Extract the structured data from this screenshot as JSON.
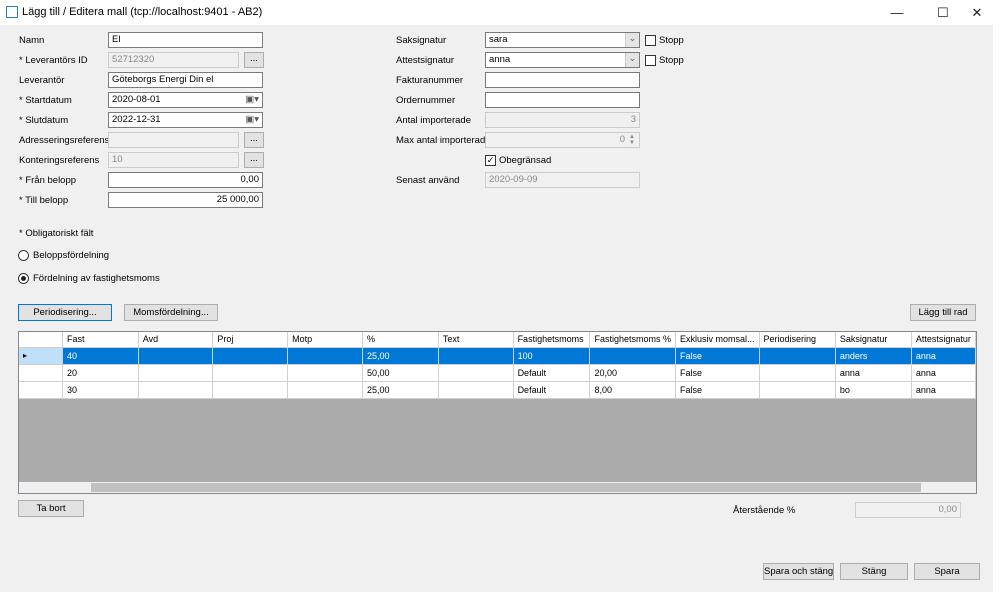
{
  "window": {
    "title": "Lägg till / Editera mall (tcp://localhost:9401 - AB2)"
  },
  "left": {
    "namn": {
      "label": "Namn",
      "value": "El"
    },
    "leverantor_id": {
      "label": "* Leverantörs ID",
      "value": "52712320"
    },
    "leverantor": {
      "label": "Leverantör",
      "value": "Göteborgs Energi Din el"
    },
    "startdatum": {
      "label": "* Startdatum",
      "value": "2020-08-01"
    },
    "slutdatum": {
      "label": "* Slutdatum",
      "value": "2022-12-31"
    },
    "adressering": {
      "label": "Adresseringsreferens",
      "value": ""
    },
    "kontering": {
      "label": "Konteringsreferens",
      "value": "10"
    },
    "fran": {
      "label": "* Från belopp",
      "value": "0,00"
    },
    "till": {
      "label": "* Till belopp",
      "value": "25 000,00"
    },
    "browse": "...",
    "required_note": "* Obligatoriskt fält",
    "radio1": "Beloppsfördelning",
    "radio2": "Fördelning av fastighetsmoms"
  },
  "right": {
    "saksignatur": {
      "label": "Saksignatur",
      "value": "sara"
    },
    "attestsignatur": {
      "label": "Attestsignatur",
      "value": "anna"
    },
    "stopp": "Stopp",
    "fakturanummer": {
      "label": "Fakturanummer",
      "value": ""
    },
    "ordernummer": {
      "label": "Ordernummer",
      "value": ""
    },
    "antal": {
      "label": "Antal importerade",
      "value": "3"
    },
    "max": {
      "label": "Max antal importerade",
      "value": "0"
    },
    "obegransad": "Obegränsad",
    "senast": {
      "label": "Senast använd",
      "value": "2020-09-09"
    }
  },
  "buttons": {
    "periodisering": "Periodisering...",
    "moms": "Momsfördelning...",
    "add_row": "Lägg till rad",
    "delete": "Ta bort",
    "save_close": "Spara och stäng",
    "close": "Stäng",
    "save": "Spara"
  },
  "grid": {
    "columns": [
      "Fast",
      "Avd",
      "Proj",
      "Motp",
      "%",
      "Text",
      "Fastighetsmoms",
      "Fastighetsmoms %",
      "Exklusiv momsal...",
      "Periodisering",
      "Saksignatur",
      "Attestsignatur"
    ],
    "rows": [
      [
        "40",
        "",
        "",
        "",
        "25,00",
        "",
        "100",
        "",
        "False",
        "",
        "anders",
        "anna"
      ],
      [
        "20",
        "",
        "",
        "",
        "50,00",
        "",
        "Default",
        "20,00",
        "False",
        "",
        "anna",
        "anna"
      ],
      [
        "30",
        "",
        "",
        "",
        "25,00",
        "",
        "Default",
        "8,00",
        "False",
        "",
        "bo",
        "anna"
      ]
    ]
  },
  "remaining": {
    "label": "Återstående %",
    "value": "0,00"
  }
}
